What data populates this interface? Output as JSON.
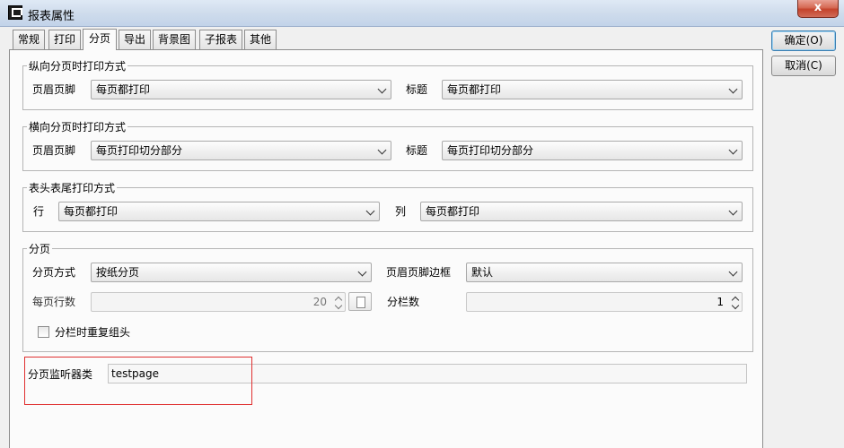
{
  "window": {
    "title": "报表属性",
    "close_symbol": "x"
  },
  "tabs": [
    {
      "label": "常规"
    },
    {
      "label": "打印"
    },
    {
      "label": "分页",
      "active": true
    },
    {
      "label": "导出"
    },
    {
      "label": "背景图"
    },
    {
      "label": "子报表"
    },
    {
      "label": "其他"
    }
  ],
  "vertical_group": {
    "legend": "纵向分页时打印方式",
    "header_footer_label": "页眉页脚",
    "header_footer_value": "每页都打印",
    "title_label": "标题",
    "title_value": "每页都打印"
  },
  "horizontal_group": {
    "legend": "横向分页时打印方式",
    "header_footer_label": "页眉页脚",
    "header_footer_value": "每页打印切分部分",
    "title_label": "标题",
    "title_value": "每页打印切分部分"
  },
  "table_header_group": {
    "legend": "表头表尾打印方式",
    "row_label": "行",
    "row_value": "每页都打印",
    "col_label": "列",
    "col_value": "每页都打印"
  },
  "paging_group": {
    "legend": "分页",
    "mode_label": "分页方式",
    "mode_value": "按纸分页",
    "hf_border_label": "页眉页脚边框",
    "hf_border_value": "默认",
    "rows_per_page_label": "每页行数",
    "rows_per_page_value": "20",
    "columns_label": "分栏数",
    "columns_value": "1",
    "repeat_group_label": "分栏时重复组头",
    "repeat_group_checked": false
  },
  "listener": {
    "label": "分页监听器类",
    "value": "testpage"
  },
  "buttons": {
    "ok": "确定(O)",
    "cancel": "取消(C)"
  },
  "colors": {
    "highlight": "#e03030",
    "default_button_border": "#3c7fb1"
  }
}
